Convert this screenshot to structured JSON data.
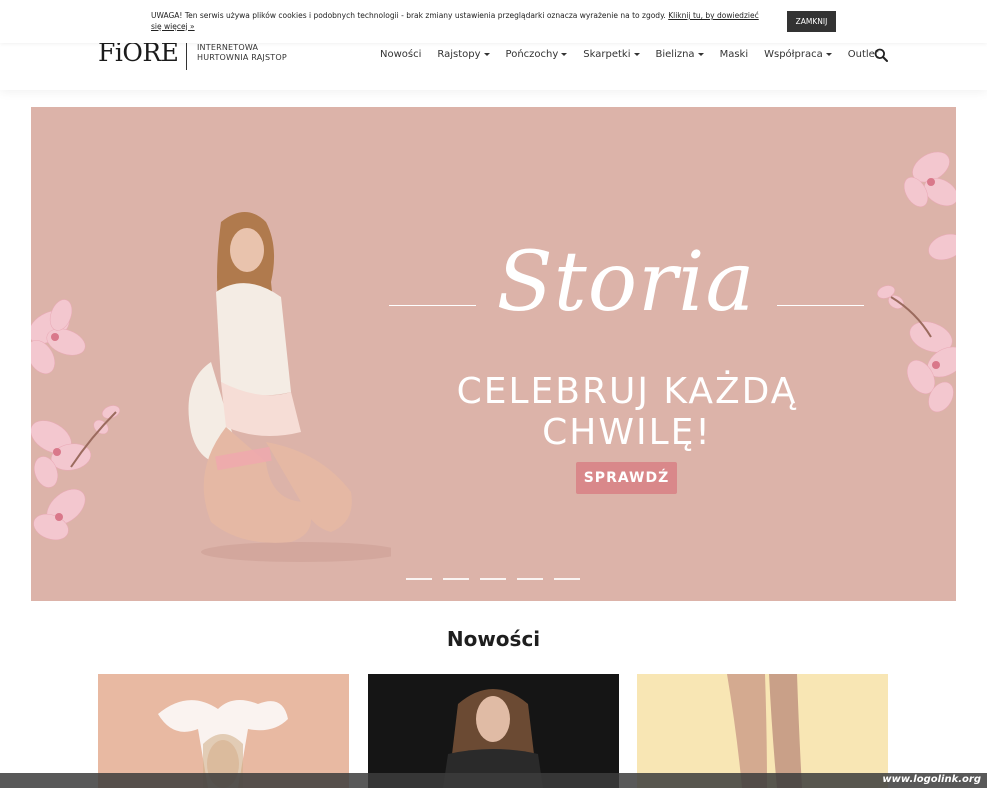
{
  "cookie": {
    "text": "UWAGA! Ten serwis używa plików cookies i podobnych technologii - brak zmiany ustawienia przeglądarki oznacza wyrażenie na to zgody.",
    "link": "Kliknij tu, by dowiedzieć się więcej »",
    "button": "ZAMKNIJ"
  },
  "header": {
    "logo": "FiORE",
    "tagline_line1": "INTERNETOWA",
    "tagline_line2": "HURTOWNIA RAJSTOP"
  },
  "nav": {
    "items": [
      {
        "label": "Nowości",
        "dropdown": false
      },
      {
        "label": "Rajstopy",
        "dropdown": true
      },
      {
        "label": "Pończochy",
        "dropdown": true
      },
      {
        "label": "Skarpetki",
        "dropdown": true
      },
      {
        "label": "Bielizna",
        "dropdown": true
      },
      {
        "label": "Maski",
        "dropdown": false
      },
      {
        "label": "Współpraca",
        "dropdown": true
      },
      {
        "label": "Outlet",
        "dropdown": false
      }
    ],
    "search_icon": "search-icon"
  },
  "hero": {
    "title": "Storia",
    "subtitle": "CELEBRUJ KAŻDĄ CHWILĘ!",
    "button": "SPRAWDŹ",
    "slides": 5,
    "background_color": "#dcb3a9",
    "button_color": "#d9888a"
  },
  "section": {
    "title": "Nowości"
  },
  "watermark": {
    "text": "www.logolink.org"
  }
}
